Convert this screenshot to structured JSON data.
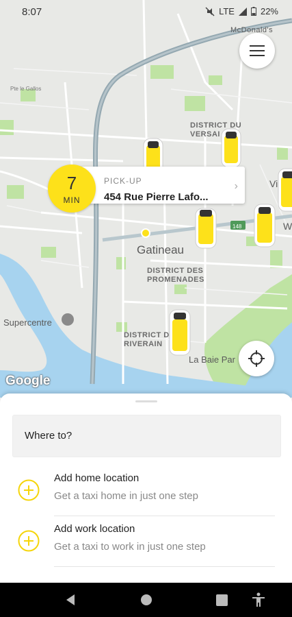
{
  "status_bar": {
    "time": "8:07",
    "network": "LTE",
    "battery": "22%"
  },
  "map": {
    "labels": {
      "mcdonalds": "McDonald's",
      "district_versailles": "DISTRICT DU\nVERSAI",
      "gatineau": "Gatineau",
      "district_promenades": "DISTRICT DES\nPROMENADES",
      "district_riverain": "DISTRICT DU\nRIVERAIN",
      "la_baie_park": "La Baie Par",
      "supercentre": "Supercentre",
      "route_148": "148",
      "vi": "Vi",
      "w": "W"
    },
    "attribution": "Google"
  },
  "pickup": {
    "eta_value": "7",
    "eta_unit": "MIN",
    "label": "PICK-UP",
    "address": "454 Rue Pierre Lafo..."
  },
  "sheet": {
    "search_placeholder": "Where to?",
    "items": [
      {
        "title": "Add home location",
        "subtitle": "Get a taxi home in just one step"
      },
      {
        "title": "Add work location",
        "subtitle": "Get a taxi to work in just one step"
      }
    ]
  },
  "colors": {
    "accent": "#fde11a",
    "park": "#bfe3a3",
    "water": "#a7d3ef",
    "road": "#ffffff",
    "highway": "#94a8b1"
  },
  "icons": [
    "menu-icon",
    "locate-icon",
    "plus-icon",
    "back-icon",
    "home-icon",
    "recents-icon",
    "accessibility-icon",
    "taxi-icon"
  ]
}
